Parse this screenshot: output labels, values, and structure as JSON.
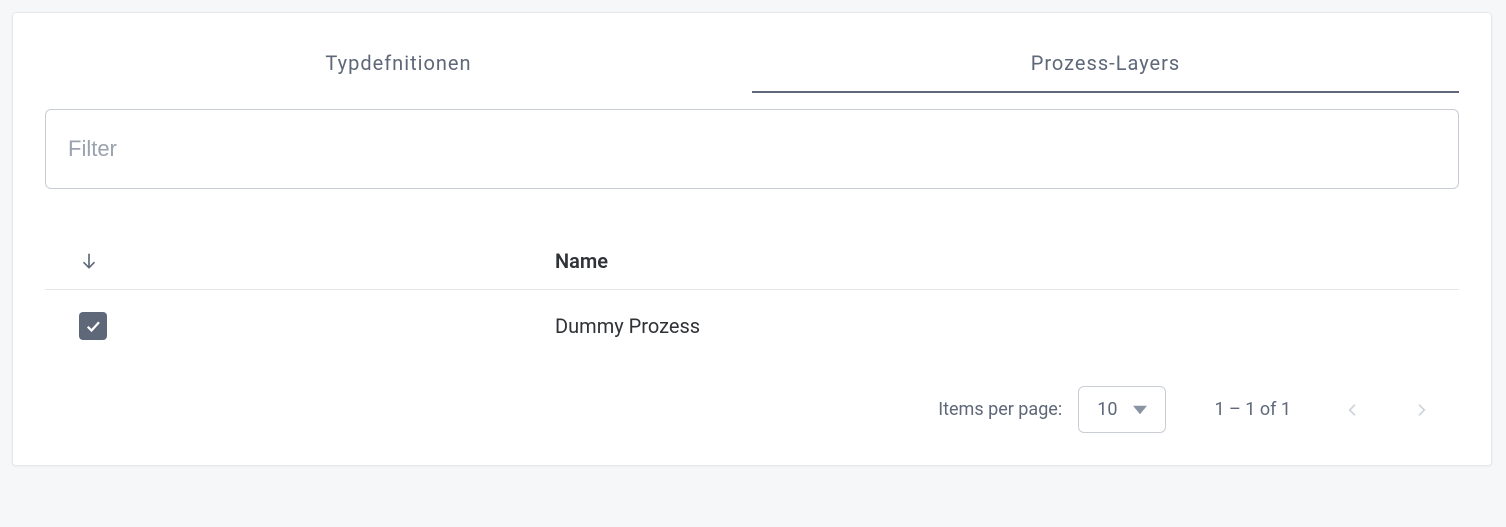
{
  "tabs": {
    "items": [
      {
        "label": "Typdefnitionen",
        "active": false
      },
      {
        "label": "Prozess-Layers",
        "active": true
      }
    ]
  },
  "filter": {
    "placeholder": "Filter",
    "value": ""
  },
  "table": {
    "sort_direction": "asc",
    "columns": {
      "name": "Name"
    },
    "rows": [
      {
        "checked": true,
        "name": "Dummy Prozess"
      }
    ]
  },
  "paginator": {
    "items_per_page_label": "Items per page:",
    "page_size": "10",
    "range_label": "1 – 1 of 1",
    "prev_disabled": true,
    "next_disabled": true
  }
}
